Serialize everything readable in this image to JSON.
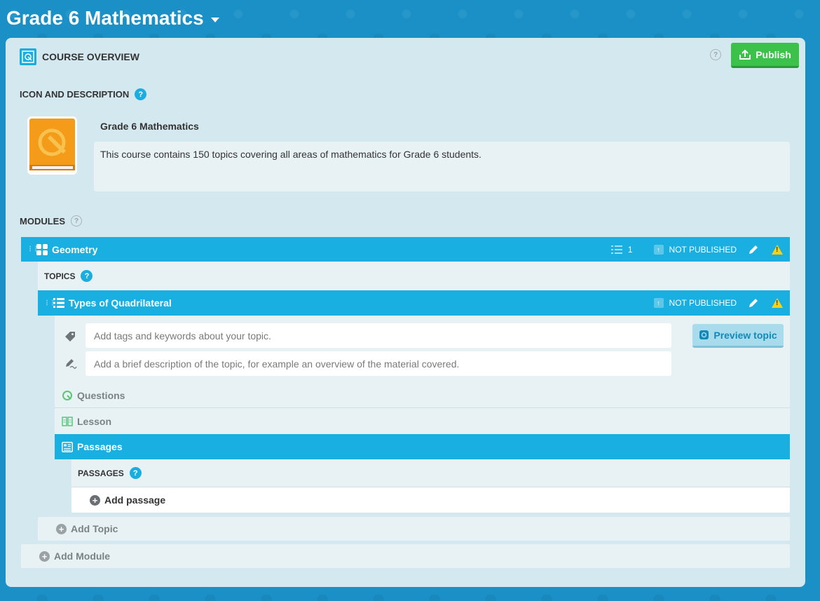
{
  "header": {
    "title": "Grade 6 Mathematics"
  },
  "overview": {
    "label": "COURSE OVERVIEW",
    "publish_label": "Publish"
  },
  "icon_section": {
    "label": "ICON AND DESCRIPTION",
    "course_name": "Grade 6 Mathematics",
    "description": "This course contains 150 topics covering all areas of mathematics for Grade 6 students."
  },
  "modules_section": {
    "label": "MODULES"
  },
  "module": {
    "name": "Geometry",
    "topic_count": "1",
    "status": "NOT PUBLISHED"
  },
  "topics_section": {
    "label": "TOPICS"
  },
  "topic": {
    "name": "Types of Quadrilateral",
    "status": "NOT PUBLISHED",
    "tags_placeholder": "Add tags and keywords about your topic.",
    "description_placeholder": "Add a brief description of the topic, for example an overview of the material covered.",
    "preview_label": "Preview topic",
    "questions_label": "Questions",
    "lesson_label": "Lesson",
    "passages_label": "Passages"
  },
  "passages_section": {
    "label": "PASSAGES",
    "add_label": "Add passage"
  },
  "add_topic_label": "Add Topic",
  "add_module_label": "Add Module",
  "colors": {
    "accent": "#19afe0",
    "publish": "#3cc14a",
    "panel": "#d4e8ef"
  }
}
